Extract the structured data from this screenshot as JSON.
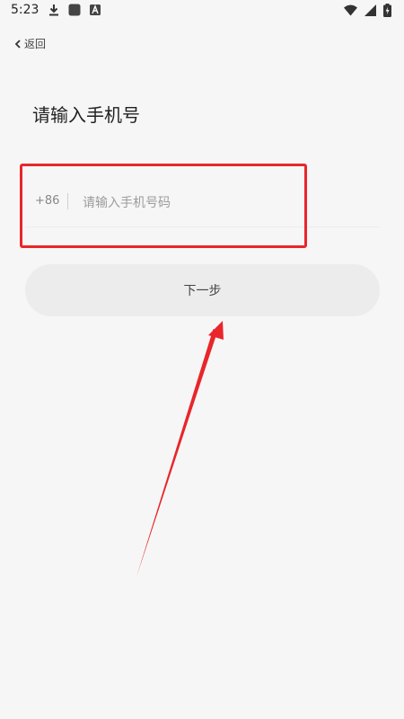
{
  "status_bar": {
    "time": "5:23",
    "left_icons": [
      "download-icon",
      "app-square-icon",
      "keyboard-a-icon"
    ],
    "right_icons": [
      "wifi-icon",
      "signal-icon",
      "battery-charging-icon"
    ]
  },
  "nav": {
    "back_label": "返回",
    "back_icon": "chevron-left-icon"
  },
  "page": {
    "title": "请输入手机号"
  },
  "phone_form": {
    "country_code": "+86",
    "phone_value": "",
    "phone_placeholder": "请输入手机号码"
  },
  "actions": {
    "next_label": "下一步"
  },
  "annotations": {
    "highlight_color": "#e8262b",
    "arrow_color": "#e8262b"
  },
  "colors": {
    "background": "#f6f6f6",
    "button_background": "#ececec",
    "placeholder": "#9c9c9c"
  }
}
